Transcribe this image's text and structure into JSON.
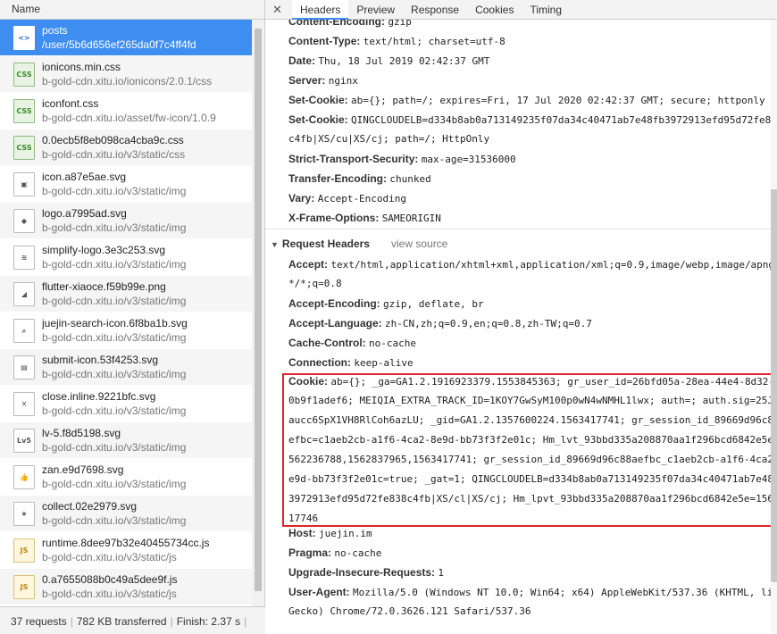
{
  "left": {
    "header": "Name",
    "requests": [
      {
        "name": "posts",
        "path": "/user/5b6d656ef265da0f7c4ff4fd",
        "icon": "<>",
        "kind": "doc",
        "selected": true
      },
      {
        "name": "ionicons.min.css",
        "path": "b-gold-cdn.xitu.io/ionicons/2.0.1/css",
        "icon": "CSS",
        "kind": "css"
      },
      {
        "name": "iconfont.css",
        "path": "b-gold-cdn.xitu.io/asset/fw-icon/1.0.9",
        "icon": "CSS",
        "kind": "css"
      },
      {
        "name": "0.0ecb5f8eb098ca4cba9c.css",
        "path": "b-gold-cdn.xitu.io/v3/static/css",
        "icon": "CSS",
        "kind": "css"
      },
      {
        "name": "icon.a87e5ae.svg",
        "path": "b-gold-cdn.xitu.io/v3/static/img",
        "icon": "▣",
        "kind": "img"
      },
      {
        "name": "logo.a7995ad.svg",
        "path": "b-gold-cdn.xitu.io/v3/static/img",
        "icon": "◆",
        "kind": "img"
      },
      {
        "name": "simplify-logo.3e3c253.svg",
        "path": "b-gold-cdn.xitu.io/v3/static/img",
        "icon": "≋",
        "kind": "img"
      },
      {
        "name": "flutter-xiaoce.f59b99e.png",
        "path": "b-gold-cdn.xitu.io/v3/static/img",
        "icon": "◢",
        "kind": "img"
      },
      {
        "name": "juejin-search-icon.6f8ba1b.svg",
        "path": "b-gold-cdn.xitu.io/v3/static/img",
        "icon": "⌕",
        "kind": "img"
      },
      {
        "name": "submit-icon.53f4253.svg",
        "path": "b-gold-cdn.xitu.io/v3/static/img",
        "icon": "▤",
        "kind": "img"
      },
      {
        "name": "close.inline.9221bfc.svg",
        "path": "b-gold-cdn.xitu.io/v3/static/img",
        "icon": "✕",
        "kind": "img"
      },
      {
        "name": "lv-5.f8d5198.svg",
        "path": "b-gold-cdn.xitu.io/v3/static/img",
        "icon": "Lv5",
        "kind": "img"
      },
      {
        "name": "zan.e9d7698.svg",
        "path": "b-gold-cdn.xitu.io/v3/static/img",
        "icon": "👍",
        "kind": "img"
      },
      {
        "name": "collect.02e2979.svg",
        "path": "b-gold-cdn.xitu.io/v3/static/img",
        "icon": "★",
        "kind": "img"
      },
      {
        "name": "runtime.8dee97b32e40455734cc.js",
        "path": "b-gold-cdn.xitu.io/v3/static/js",
        "icon": "JS",
        "kind": "js"
      },
      {
        "name": "0.a7655088b0c49a5dee9f.js",
        "path": "b-gold-cdn.xitu.io/v3/static/js",
        "icon": "JS",
        "kind": "js"
      }
    ],
    "status": {
      "requests": "37 requests",
      "transferred": "782 KB transferred",
      "finish": "Finish: 2.37 s"
    }
  },
  "tabs": {
    "close": "✕",
    "items": [
      "Headers",
      "Preview",
      "Response",
      "Cookies",
      "Timing"
    ],
    "active": "Headers"
  },
  "response_headers": [
    {
      "k": "Content-Encoding:",
      "v": "gzip"
    },
    {
      "k": "Content-Type:",
      "v": "text/html; charset=utf-8"
    },
    {
      "k": "Date:",
      "v": "Thu, 18 Jul 2019 02:42:37 GMT"
    },
    {
      "k": "Server:",
      "v": "nginx"
    },
    {
      "k": "Set-Cookie:",
      "v": "ab={}; path=/; expires=Fri, 17 Jul 2020 02:42:37 GMT; secure; httponly"
    },
    {
      "k": "Set-Cookie:",
      "v": "QINGCLOUDELB=d334b8ab0a713149235f07da34c40471ab7e48fb3972913efd95d72fe8",
      "cont": "c4fb|XS/cu|XS/cj; path=/; HttpOnly"
    },
    {
      "k": "Strict-Transport-Security:",
      "v": "max-age=31536000"
    },
    {
      "k": "Transfer-Encoding:",
      "v": "chunked"
    },
    {
      "k": "Vary:",
      "v": "Accept-Encoding"
    },
    {
      "k": "X-Frame-Options:",
      "v": "SAMEORIGIN"
    }
  ],
  "request_section": {
    "title": "Request Headers",
    "view_source": "view source"
  },
  "request_headers": [
    {
      "k": "Accept:",
      "v": "text/html,application/xhtml+xml,application/xml;q=0.9,image/webp,image/apng",
      "cont": "*/*;q=0.8"
    },
    {
      "k": "Accept-Encoding:",
      "v": "gzip, deflate, br"
    },
    {
      "k": "Accept-Language:",
      "v": "zh-CN,zh;q=0.9,en;q=0.8,zh-TW;q=0.7"
    },
    {
      "k": "Cache-Control:",
      "v": "no-cache"
    },
    {
      "k": "Connection:",
      "v": "keep-alive"
    }
  ],
  "cookie": {
    "k": "Cookie:",
    "lines": [
      "ab={}; _ga=GA1.2.1916923379.1553845363; gr_user_id=26bfd05a-28ea-44e4-8d32-",
      "0b9f1adef6; MEIQIA_EXTRA_TRACK_ID=1KOY7GwSyM100p0wN4wNMHL1lwx; auth=; auth.sig=25J",
      "aucc6SpX1VH8RlCoh6azLU; _gid=GA1.2.1357600224.1563417741; gr_session_id_89669d96c8",
      "efbc=c1aeb2cb-a1f6-4ca2-8e9d-bb73f3f2e01c; Hm_lvt_93bbd335a208870aa1f296bcd6842e5e",
      "562236788,1562837965,1563417741; gr_session_id_89669d96c88aefbc_c1aeb2cb-a1f6-4ca2",
      "e9d-bb73f3f2e01c=true; _gat=1; QINGCLOUDELB=d334b8ab0a713149235f07da34c40471ab7e48",
      "3972913efd95d72fe838c4fb|XS/cl|XS/cj; Hm_lpvt_93bbd335a208870aa1f296bcd6842e5e=156",
      "17746"
    ]
  },
  "request_headers_after": [
    {
      "k": "Host:",
      "v": "juejin.im"
    },
    {
      "k": "Pragma:",
      "v": "no-cache"
    },
    {
      "k": "Upgrade-Insecure-Requests:",
      "v": "1"
    },
    {
      "k": "User-Agent:",
      "v": "Mozilla/5.0 (Windows NT 10.0; Win64; x64) AppleWebKit/537.36 (KHTML, li",
      "cont": "Gecko) Chrome/72.0.3626.121 Safari/537.36"
    }
  ],
  "colors": {
    "selected": "#3d8ef0",
    "highlight": "#e0242b"
  }
}
